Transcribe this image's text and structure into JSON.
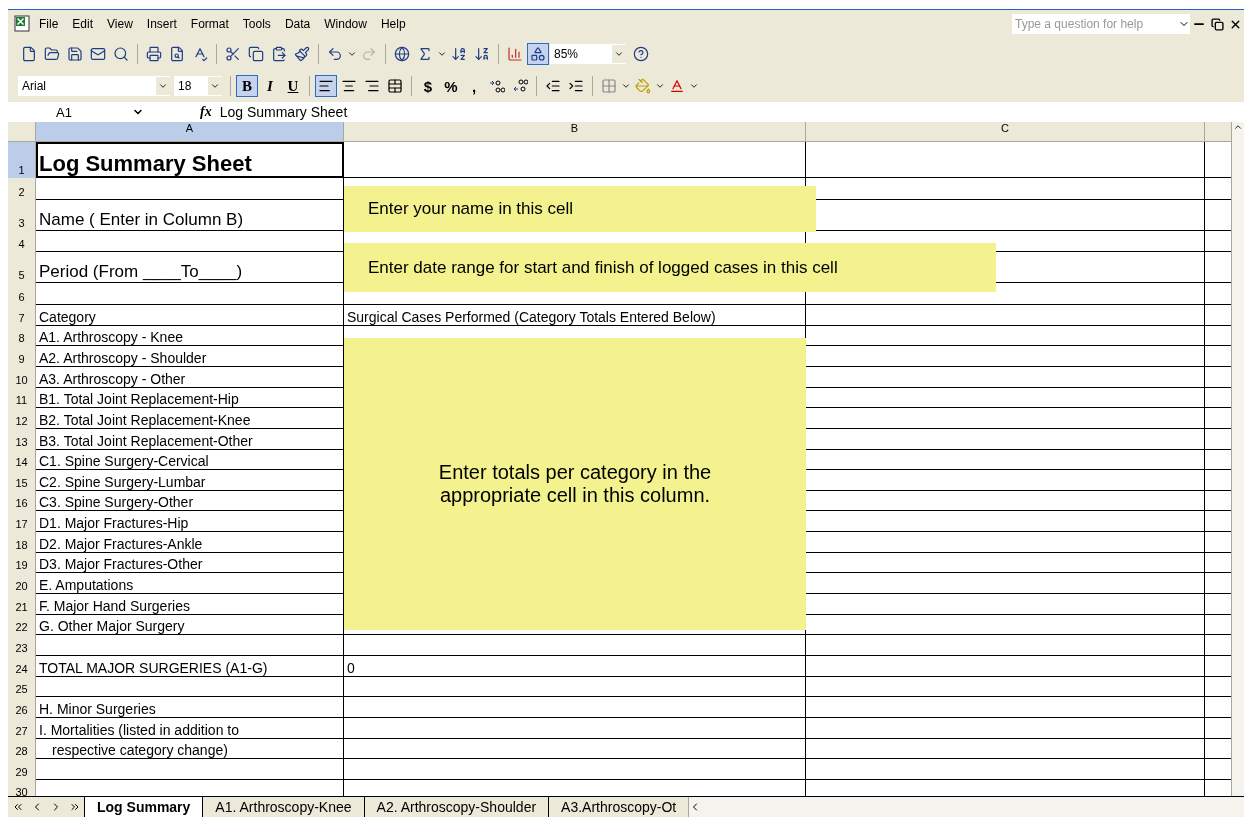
{
  "menu": {
    "items": [
      "File",
      "Edit",
      "View",
      "Insert",
      "Format",
      "Tools",
      "Data",
      "Window",
      "Help"
    ],
    "help_placeholder": "Type a question for help"
  },
  "standard_toolbar": {
    "redo_disabled": true,
    "drawing_pressed": true,
    "zoom": "85%"
  },
  "formatting_toolbar": {
    "font": "Arial",
    "size": "18",
    "styles": [
      {
        "label": "B",
        "pressed": true
      },
      {
        "label": "I",
        "pressed": false
      },
      {
        "label": "U",
        "pressed": false
      }
    ],
    "alignments": [
      {
        "selected": true
      },
      {
        "selected": false
      },
      {
        "selected": false
      },
      {
        "selected": false
      }
    ],
    "number_formats": [
      "$",
      "%",
      ","
    ]
  },
  "formula_bar": {
    "name_box": "A1",
    "fx": "fx",
    "formula": "Log Summary Sheet"
  },
  "columns": [
    {
      "label": "A",
      "selected": true
    },
    {
      "label": "B",
      "selected": false
    },
    {
      "label": "C",
      "selected": false
    }
  ],
  "rows": [
    {
      "number": "1",
      "kind": "title",
      "selected": true,
      "a": "Log Summary Sheet"
    },
    {
      "number": "2",
      "kind": "blank",
      "selected": false
    },
    {
      "number": "3",
      "kind": "label",
      "selected": false,
      "a": "Name ( Enter in Column B)"
    },
    {
      "number": "4",
      "kind": "blank",
      "selected": false
    },
    {
      "number": "5",
      "kind": "label",
      "selected": false,
      "a": "Period (From ____To____)"
    },
    {
      "number": "6",
      "kind": "blank",
      "selected": false
    },
    {
      "number": "7",
      "kind": "item",
      "selected": false,
      "a": "Category",
      "b": "Surgical Cases Performed (Category Totals Entered Below)"
    },
    {
      "number": "8",
      "kind": "item",
      "selected": false,
      "a": "A1. Arthroscopy - Knee"
    },
    {
      "number": "9",
      "kind": "item",
      "selected": false,
      "a": "A2. Arthroscopy - Shoulder"
    },
    {
      "number": "10",
      "kind": "item",
      "selected": false,
      "a": "A3. Arthroscopy - Other"
    },
    {
      "number": "11",
      "kind": "item",
      "selected": false,
      "a": "B1. Total Joint Replacement-Hip"
    },
    {
      "number": "12",
      "kind": "item",
      "selected": false,
      "a": "B2. Total Joint Replacement-Knee"
    },
    {
      "number": "13",
      "kind": "item",
      "selected": false,
      "a": "B3. Total Joint Replacement-Other"
    },
    {
      "number": "14",
      "kind": "item",
      "selected": false,
      "a": "C1. Spine Surgery-Cervical"
    },
    {
      "number": "15",
      "kind": "item",
      "selected": false,
      "a": "C2. Spine Surgery-Lumbar"
    },
    {
      "number": "16",
      "kind": "item",
      "selected": false,
      "a": "C3. Spine Surgery-Other"
    },
    {
      "number": "17",
      "kind": "item",
      "selected": false,
      "a": "D1. Major Fractures-Hip"
    },
    {
      "number": "18",
      "kind": "item",
      "selected": false,
      "a": "D2. Major Fractures-Ankle"
    },
    {
      "number": "19",
      "kind": "item",
      "selected": false,
      "a": "D3. Major Fractures-Other"
    },
    {
      "number": "20",
      "kind": "item",
      "selected": false,
      "a": "E. Amputations"
    },
    {
      "number": "21",
      "kind": "item",
      "selected": false,
      "a": "F. Major Hand Surgeries"
    },
    {
      "number": "22",
      "kind": "item",
      "selected": false,
      "a": "G. Other Major Surgery"
    },
    {
      "number": "23",
      "kind": "item",
      "selected": false
    },
    {
      "number": "24",
      "kind": "item",
      "selected": false,
      "a": "TOTAL MAJOR SURGERIES (A1-G)",
      "b": "0"
    },
    {
      "number": "25",
      "kind": "item",
      "selected": false
    },
    {
      "number": "26",
      "kind": "item",
      "selected": false,
      "a": "H. Minor Surgeries"
    },
    {
      "number": "27",
      "kind": "item",
      "selected": false,
      "a": "I. Mortalities (listed in addition to"
    },
    {
      "number": "28",
      "kind": "indented",
      "selected": false,
      "a": "respective category change)"
    },
    {
      "number": "29",
      "kind": "item",
      "selected": false
    },
    {
      "number": "30",
      "kind": "partial",
      "selected": false
    }
  ],
  "notes": [
    {
      "kind": "short",
      "text": "Enter your name in this cell"
    },
    {
      "kind": "wide",
      "text": "Enter date range for start and finish of logged cases in this cell"
    },
    {
      "kind": "large",
      "text": "Enter totals per category in the appropriate cell in this column."
    }
  ],
  "sheet_tabs": [
    {
      "label": "Log Summary",
      "selected": true
    },
    {
      "label": "A1. Arthroscopy-Knee",
      "selected": false
    },
    {
      "label": "A2. Arthroscopy-Shoulder",
      "selected": false
    },
    {
      "label": "A3.Arthroscopy-Ot",
      "selected": false
    }
  ]
}
